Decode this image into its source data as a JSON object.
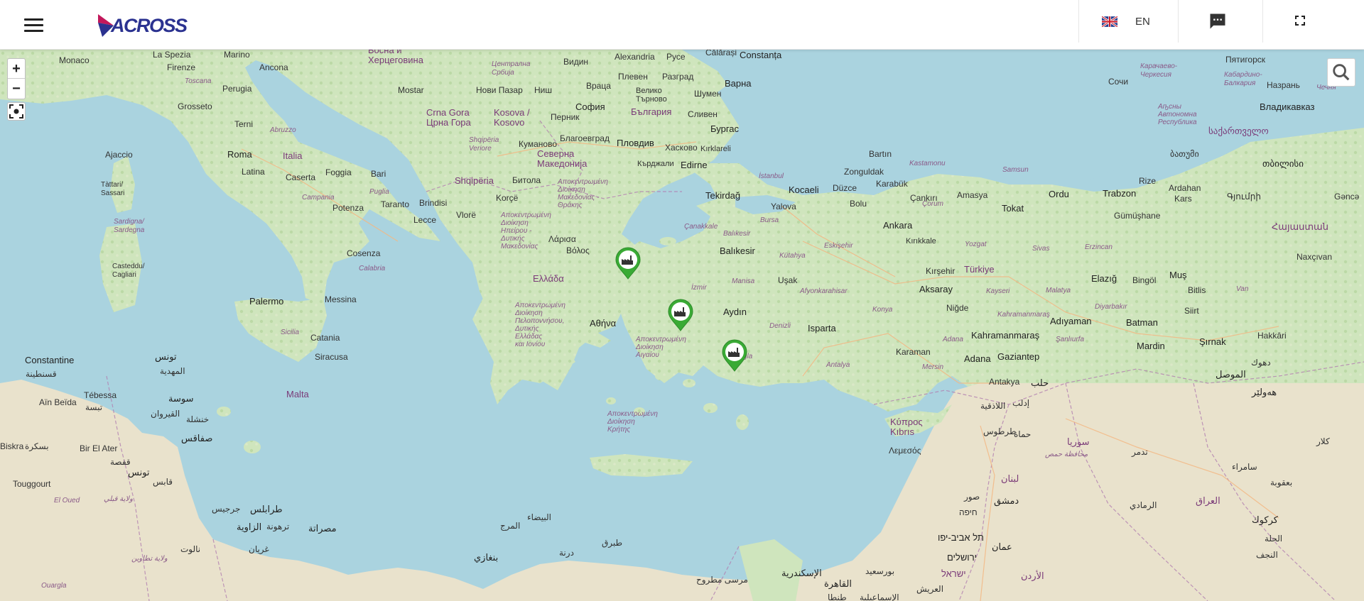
{
  "header": {
    "logo_text": "ACROSS",
    "language_code": "EN",
    "menu_icon": "hamburger-menu-icon",
    "chat_icon": "chat-bubble-icon",
    "fullscreen_icon": "fullscreen-icon"
  },
  "map_controls": {
    "zoom_in_label": "+",
    "zoom_out_label": "−",
    "locate_icon": "locate-icon",
    "search_icon": "search-icon"
  },
  "markers": [
    {
      "name": "terminal-marker-1",
      "icon": "factory-icon",
      "color": "#3aaa35"
    },
    {
      "name": "terminal-marker-2",
      "icon": "factory-icon",
      "color": "#3aaa35"
    },
    {
      "name": "terminal-marker-3",
      "icon": "factory-icon",
      "color": "#3aaa35"
    }
  ],
  "labels": {
    "monaco": "Monaco",
    "la_spezia": "La Spezia",
    "marino": "Marino",
    "firenze": "Firenze",
    "ancona": "Ancona",
    "toscana": "Toscana",
    "perugia": "Perugia",
    "grosseto": "Grosseto",
    "abruzzo": "Abruzzo",
    "roma": "Roma",
    "italia": "Italia",
    "terni": "Terni",
    "latina": "Latina",
    "caserta": "Caserta",
    "foggia": "Foggia",
    "bari": "Bari",
    "campania": "Campania",
    "puglia": "Puglia",
    "taranto": "Taranto",
    "brindisi": "Brindisi",
    "lecce": "Lecce",
    "potenza": "Potenza",
    "cosenza": "Cosenza",
    "calabria": "Calabria",
    "ajaccio": "Ajaccio",
    "tattari": "Tàttari/\nSassari",
    "sardigna": "Sardigna/\nSardegna",
    "casteddu": "Casteddu/\nCagliari",
    "palermo": "Palermo",
    "messina": "Messina",
    "sicilia": "Sicilia",
    "catania": "Catania",
    "siracusa": "Siracusa",
    "malta": "Malta",
    "constantine": "Constantine",
    "bosna": "Босна и\nХерцеговина",
    "crna_gora": "Crna Gora\nЦрна Гора",
    "kosova": "Kosova /\nKosovo",
    "srbija": "Централна\nСрбија",
    "nis": "Ниш",
    "novi_pazar": "Нови Пазар",
    "mostar": "Mostar",
    "vraca": "Враца",
    "vidin": "Видин",
    "alexandria": "Alexandria",
    "ruse": "Русе",
    "calarasi": "Călărași",
    "constanta": "Constanța",
    "pleven": "Плевен",
    "razgrad": "Разград",
    "varna": "Варна",
    "sofia": "София",
    "bulgaria": "България",
    "veliko": "Велико\nТърново",
    "shumen": "Шумен",
    "burgas": "Бургас",
    "sliven": "Сливен",
    "pernik": "Перник",
    "blagoevgrad": "Благоевград",
    "plovdiv": "Пловдив",
    "haskovo": "Хасково",
    "kardzhali": "Кърджали",
    "kumanovo": "Куманово",
    "makedonija": "Северна\nМакедонија",
    "shqiperia": "Shqipëria",
    "shqiperia_region": "Shqipëria\nVeriore",
    "bitola": "Битола",
    "korce": "Korçë",
    "vlore": "Vlorë",
    "edirne": "Edirne",
    "kirklareli": "Kırklareli",
    "tekirdag": "Tekirdağ",
    "istanbul": "İstanbul",
    "kocaeli": "Kocaeli",
    "duzce": "Düzce",
    "bolu": "Bolu",
    "yalova": "Yalova",
    "bursa": "Bursa",
    "canakkale": "Çanakkale",
    "balikesir_region": "Balıkesir",
    "balikesir": "Balıkesir",
    "kutahya": "Kütahya",
    "eskisehir": "Eskişehir",
    "ankara": "Ankara",
    "kirikkale": "Kırıkkale",
    "yozgat": "Yozgat",
    "corum": "Çorum",
    "amasya": "Amasya",
    "tokat": "Tokat",
    "ordu": "Ordu",
    "trabzon": "Trabzon",
    "zonguldak": "Zonguldak",
    "karabuk": "Karabük",
    "bartin": "Bartın",
    "kastamonu": "Kastamonu",
    "cankiri": "Çankırı",
    "samsun": "Samsun",
    "rize": "Rize",
    "gumushane": "Gümüşhane",
    "erzincan": "Erzincan",
    "sivas": "Sivas",
    "kirsehir": "Kırşehir",
    "turkiye": "Türkiye",
    "aksaray": "Aksaray",
    "nigde": "Niğde",
    "kayseri": "Kayseri",
    "malatya": "Malatya",
    "elazig": "Elazığ",
    "bingol": "Bingöl",
    "mus": "Muş",
    "bitlis": "Bitlis",
    "van": "Van",
    "siirt": "Siirt",
    "batman": "Batman",
    "diyarbakir": "Diyarbakır",
    "adiyaman": "Adıyaman",
    "kahramanmaras": "Kahramanmaraş",
    "kahramanmaras_region": "Kahramanmaraş",
    "gaziantep": "Gaziantep",
    "sanliurfa": "Şanlıurfa",
    "mardin": "Mardin",
    "sirnak": "Şırnak",
    "hakkari": "Hakkâri",
    "adana": "Adana",
    "adana_region": "Adana",
    "mersin": "Mersin",
    "karaman": "Karaman",
    "konya": "Konya",
    "antalya": "Antalya",
    "isparta": "Isparta",
    "afyon": "Afyonkarahisar",
    "usak": "Uşak",
    "manisa": "Manisa",
    "izmir": "İzmir",
    "aydin": "Aydın",
    "denizli": "Denizli",
    "mugla": "Muğla",
    "ardahan": "Ardahan",
    "kars": "Kars",
    "ganca": "Gəncə",
    "nakhchivan": "Naxçıvan",
    "sochi": "Сочи",
    "pyatigorsk": "Пятигорск",
    "vladikavkaz": "Владикавказ",
    "nazran": "Назрань",
    "chechnya": "Чечня",
    "sakartvelo": "საქართველო",
    "tbilisi": "თბილისი",
    "batumi": "ბათუმი",
    "kabardino": "Кабардино-\nБалкария",
    "karachaevo": "Карачаево-\nЧеркесия",
    "abkhazia": "Аҧсны\nАвтономна\nРеспублика",
    "armenia": "Հայաստան",
    "gyumri": "Գյումրի",
    "ellada": "Ελλάδα",
    "larisa": "Λάρισα",
    "volos": "Βόλος",
    "athina": "Αθήνα",
    "makedonia_region": "Αποκεντρωμένη\nΔιοίκηση\nΜακεδονίας -\nΘράκης",
    "ipeiros_region": "Αποκεντρωμένη\nΔιοίκηση\nΗπείρου -\nΔυτικής\nΜακεδονίας",
    "peloponnisos_region": "Αποκεντρωμένη\nΔιοίκηση\nΠελοποννήσου,\nΔυτικής\nΕλλάδας\nκαι Ιονίου",
    "aigaiou_region": "Αποκεντρωμένη\nΔιοίκηση\nΑιγαίου",
    "kritis_region": "Αποκεντρωμένη\nΔιοίκηση\nΚρήτης",
    "kypros": "Κύπρος\nKıbrıs",
    "lemesos": "Λεμεσός",
    "antakya": "Antakya",
    "halab": "حلب",
    "idlib": "إدلب",
    "lattakia": "اللاذقية",
    "tartus": "طرطوس",
    "hama": "حماة",
    "homs": "محافظة حمص",
    "suria": "سوريا",
    "tadmur": "تدمر",
    "dimashq": "دمشق",
    "lubnan": "لبنان",
    "sur": "صور",
    "haifa": "חיפה",
    "tel_aviv": "תל אביב-יפו",
    "yerushalayim": "ירושלים",
    "amman": "عمان",
    "urdun": "الأردن",
    "israel": "ישראל",
    "iraq": "العراق",
    "mosul": "الموصل",
    "erbil": "هەولێر",
    "dohuk": "دهوك",
    "kirkuk": "كركوك",
    "baqubah": "بعقوبة",
    "kalar": "كلار",
    "samarra": "سامراء",
    "ramadi": "الرمادي",
    "hillah": "الحلة",
    "najaf": "النجف",
    "iskandariya": "الإسكندرية",
    "qahira": "القاهرة",
    "tanta": "طنطا",
    "ismailia": "الإسماعيلية",
    "port_said": "بورسعيد",
    "arish": "العريش",
    "marsa_matruh": "مرسى مطروح",
    "tobruk": "طبرق",
    "darnah": "درنة",
    "bayda": "البيضاء",
    "marj": "المرج",
    "benghazi": "بنغازي",
    "tarabulus": "طرابلس",
    "misrata": "مصراتة",
    "zawiya": "الزاوية",
    "tarhuna": "ترهونة",
    "gharyan": "غريان",
    "nalut": "نالوت",
    "tunis": "تونس",
    "sousse": "سوسة",
    "sfax": "صفاقس",
    "kairouan": "القيروان",
    "gafsa": "قفصة",
    "gabes": "قابس",
    "tebessa": "Tébessa",
    "tebessa_ar": "تبسة",
    "ain_beida": "Aïn Beïda",
    "biskra": "Biskra",
    "biskra_ar": "بسكرة",
    "bir_el_ater": "Bir El Ater",
    "touggourt": "Touggourt",
    "el_oued": "El Oued",
    "ouargla": "Ouargla",
    "tunisia": "تونس",
    "qusantina": "قسنطينة",
    "khenchela": "خنشلة",
    "mahdia": "المهدية",
    "djerba": "جرجيس",
    "tataouine": "ولاية تطاوين",
    "kebili": "ولاية قبلي"
  }
}
